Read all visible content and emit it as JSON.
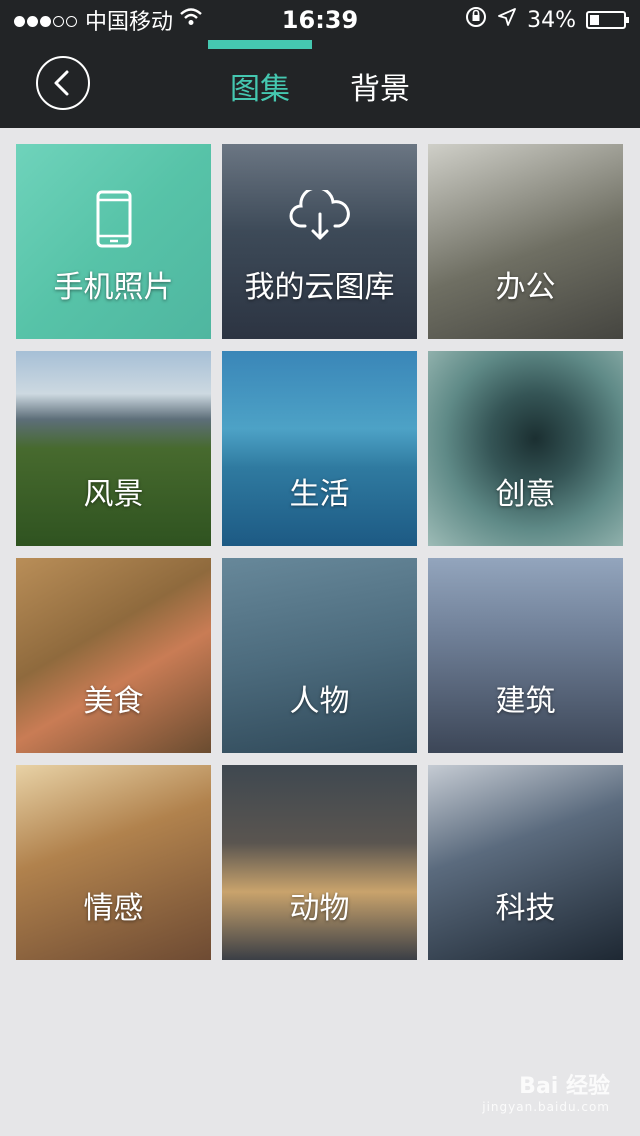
{
  "status_bar": {
    "carrier": "中国移动",
    "time": "16:39",
    "battery_percent": "34%",
    "signal_dots_filled": 3,
    "signal_dots_total": 5
  },
  "navbar": {
    "back_icon": "chevron-left-icon",
    "tabs": [
      {
        "label": "图集",
        "active": true
      },
      {
        "label": "背景",
        "active": false
      }
    ],
    "accent_color": "#45c7b0"
  },
  "categories": [
    {
      "label": "手机照片",
      "icon": "phone-icon"
    },
    {
      "label": "我的云图库",
      "icon": "cloud-download-icon"
    },
    {
      "label": "办公"
    },
    {
      "label": "风景"
    },
    {
      "label": "生活"
    },
    {
      "label": "创意"
    },
    {
      "label": "美食"
    },
    {
      "label": "人物"
    },
    {
      "label": "建筑"
    },
    {
      "label": "情感"
    },
    {
      "label": "动物"
    },
    {
      "label": "科技"
    }
  ],
  "watermark": {
    "text": "Bai 经验",
    "sub": "jingyan.baidu.com"
  }
}
